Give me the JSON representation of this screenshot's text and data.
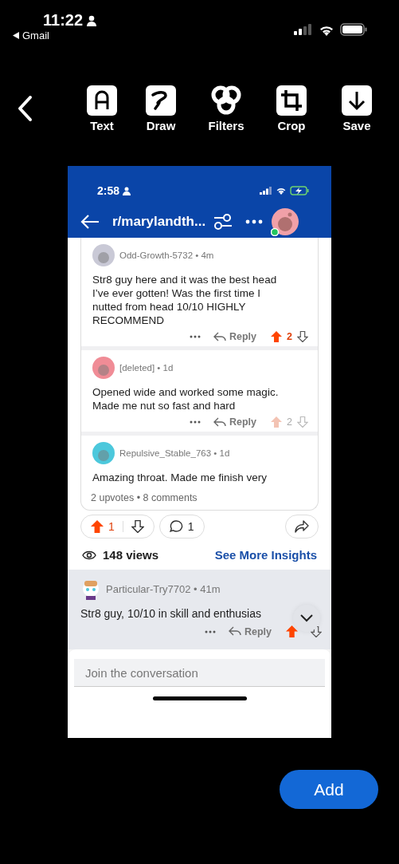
{
  "status_bar": {
    "time": "11:22",
    "back_app": "Gmail"
  },
  "editor_toolbar": {
    "tools": [
      {
        "label": "Text",
        "kind": "text"
      },
      {
        "label": "Draw",
        "kind": "draw"
      },
      {
        "label": "Filters",
        "kind": "filters"
      },
      {
        "label": "Crop",
        "kind": "crop"
      },
      {
        "label": "Save",
        "kind": "save"
      }
    ]
  },
  "screenshot": {
    "status_bar": {
      "time": "2:58"
    },
    "header": {
      "title": "r/marylandth..."
    },
    "comments": [
      {
        "meta": "Odd-Growth-5732 • 4m",
        "body": "Str8 guy here and it was the best head I’ve ever gotten! Was the first time I nutted from head 10/10 HIGHLY RECOMMEND",
        "color": "#c9c9d6",
        "reply": "Reply",
        "votes": "2",
        "dimmed": false
      },
      {
        "meta": "[deleted] • 1d",
        "body": "Opened wide and worked some magic. Made me nut so fast and hard",
        "color": "#f08c96",
        "reply": "Reply",
        "votes": "2",
        "dimmed": true
      },
      {
        "meta": "Repulsive_Stable_763 • 1d",
        "body": "Amazing throat. Made me finish very",
        "color": "#4cc8dc"
      }
    ],
    "post_summary": "2 upvotes • 8 comments",
    "post_actions": {
      "upvotes": "1",
      "upvoted": true,
      "comments": "1"
    },
    "views": "148 views",
    "insights_link": "See More Insights",
    "pinned_comment": {
      "meta": "Particular-Try7702 • 41m",
      "body": "Str8 guy, 10/10 in skill and enthusias",
      "reply": "Reply",
      "upvoted": true
    },
    "composer": {
      "placeholder": "Join the conversation"
    }
  },
  "add_button": "Add"
}
